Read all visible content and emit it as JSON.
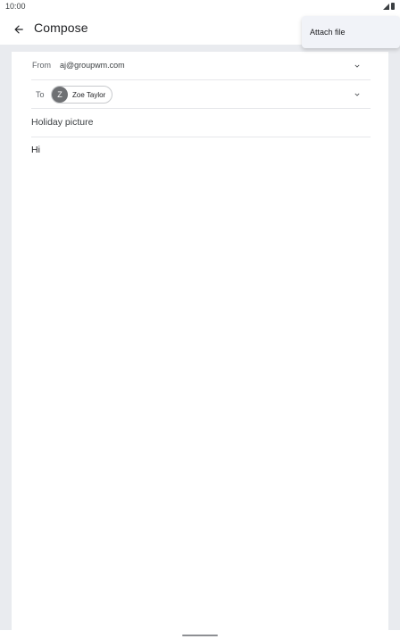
{
  "status_bar": {
    "time": "10:00"
  },
  "app_bar": {
    "title": "Compose"
  },
  "menu": {
    "items": [
      {
        "label": "Attach file"
      }
    ]
  },
  "compose": {
    "from_label": "From",
    "from_value": "aj@groupwm.com",
    "to_label": "To",
    "recipient": {
      "initial": "Z",
      "name": "Zoe Taylor"
    },
    "subject": "Holiday picture",
    "body": "Hi"
  },
  "icons": {
    "back": "arrow-back-icon",
    "chevron": "chevron-down-icon",
    "signal": "signal-icon",
    "battery": "battery-icon"
  },
  "colors": {
    "background": "#e9ebef",
    "surface": "#ffffff",
    "menu_surface": "#f1f3f8",
    "avatar": "#6f7174",
    "text": "#202124"
  }
}
